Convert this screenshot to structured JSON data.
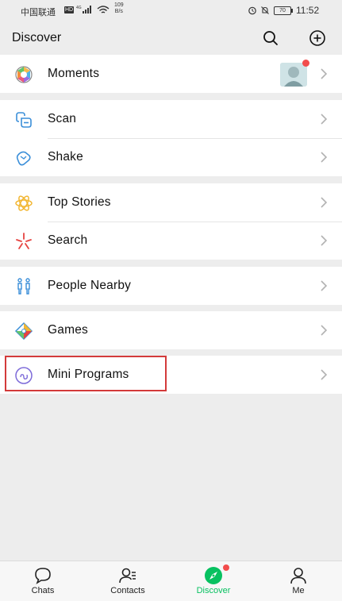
{
  "status_bar": {
    "carrier": "中国联通",
    "hd": "HD",
    "network": "4G",
    "speed_value": "109",
    "speed_unit": "B/s",
    "battery": "70",
    "time": "11:52"
  },
  "header": {
    "title": "Discover",
    "search_icon": "search-icon",
    "add_icon": "plus-circle-icon"
  },
  "groups": [
    {
      "items": [
        {
          "label": "Moments",
          "icon": "moments-icon",
          "has_thumbnail": true,
          "has_badge": true
        }
      ]
    },
    {
      "items": [
        {
          "label": "Scan",
          "icon": "scan-icon"
        },
        {
          "label": "Shake",
          "icon": "shake-icon"
        }
      ]
    },
    {
      "items": [
        {
          "label": "Top Stories",
          "icon": "top-stories-icon"
        },
        {
          "label": "Search",
          "icon": "search-sparkle-icon"
        }
      ]
    },
    {
      "items": [
        {
          "label": "People Nearby",
          "icon": "people-nearby-icon"
        }
      ]
    },
    {
      "items": [
        {
          "label": "Games",
          "icon": "games-icon"
        }
      ]
    },
    {
      "items": [
        {
          "label": "Mini Programs",
          "icon": "mini-programs-icon",
          "highlighted": true
        }
      ]
    }
  ],
  "tabbar": {
    "tabs": [
      {
        "label": "Chats",
        "icon": "chat-bubble-icon",
        "active": false
      },
      {
        "label": "Contacts",
        "icon": "contacts-icon",
        "active": false
      },
      {
        "label": "Discover",
        "icon": "compass-icon",
        "active": true,
        "has_badge": true
      },
      {
        "label": "Me",
        "icon": "person-icon",
        "active": false
      }
    ]
  },
  "colors": {
    "accent": "#07c160",
    "badge": "#f24c4c",
    "highlight_box": "#d33a3a",
    "background": "#ededed"
  }
}
